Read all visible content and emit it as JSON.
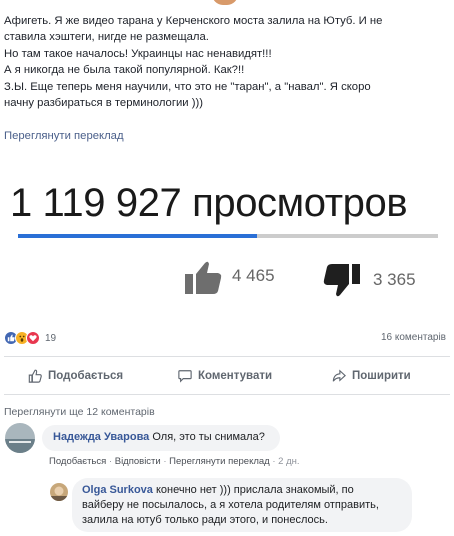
{
  "post": {
    "lines": [
      "Афигеть. Я же видео тарана у Керченского моста залила на Ютуб. И не",
      "ставила хэштеги, нигде не размещала.",
      "Но там такое началось! Украинцы нас ненавидят!!!",
      "А я никогда не была такой популярной. Как?!!",
      "З.Ы. Еще теперь меня научили, что это не \"таран\", а \"навал\". Я скоро",
      "начну разбираться в терминологии )))"
    ],
    "translate_link": "Переглянути переклад"
  },
  "video": {
    "views": "1 119 927 просмотров",
    "likes": "4 465",
    "dislikes": "3 365",
    "like_ratio": 0.57
  },
  "stats": {
    "reactions_count": "19",
    "comments_count": "16 коментарів"
  },
  "actions": {
    "like": "Подобається",
    "comment": "Коментувати",
    "share": "Поширити"
  },
  "comments_section": {
    "view_more": "Переглянути ще 12 коментарів"
  },
  "comments": [
    {
      "author": "Надежда Уварова",
      "text": "Оля, это ты снимала?",
      "actions": [
        "Подобається",
        "Відповісти",
        "Переглянути переклад",
        "2 дн."
      ]
    },
    {
      "author": "Olga Surkova",
      "text_lines": [
        "конечно нет ))) прислала знакомый, по",
        "вайберу не посылалось, а я хотела родителям отправить,",
        "залила на ютуб только ради этого, и понеслось."
      ]
    }
  ],
  "colors": {
    "link": "#385898",
    "progress": "#2a6fd6",
    "bubble": "#f2f3f5"
  }
}
